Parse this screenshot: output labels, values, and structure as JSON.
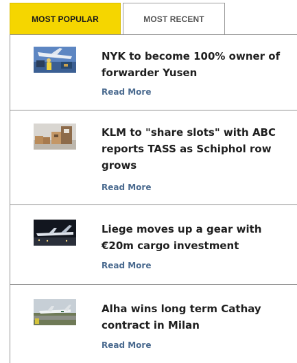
{
  "tabs": {
    "popular_label": "MOST POPULAR",
    "recent_label": "MOST RECENT"
  },
  "colors": {
    "active_tab": "#f5d600",
    "link": "#4a6a8f",
    "divider": "#8f8f8f"
  },
  "articles": [
    {
      "title": "NYK to become 100% owner of forwarder Yusen",
      "link": "Read More",
      "image_icon": "aircraft-loading-photo"
    },
    {
      "title": "KLM to \"share slots\" with ABC reports TASS as Schiphol row grows",
      "link": "Read More",
      "image_icon": "cargo-boxes-photo"
    },
    {
      "title": "Liege moves up a gear with €20m cargo investment",
      "link": "Read More",
      "image_icon": "night-airport-photo"
    },
    {
      "title": "Alha wins long term Cathay contract in Milan",
      "link": "Read More",
      "image_icon": "runway-aircraft-photo"
    }
  ]
}
